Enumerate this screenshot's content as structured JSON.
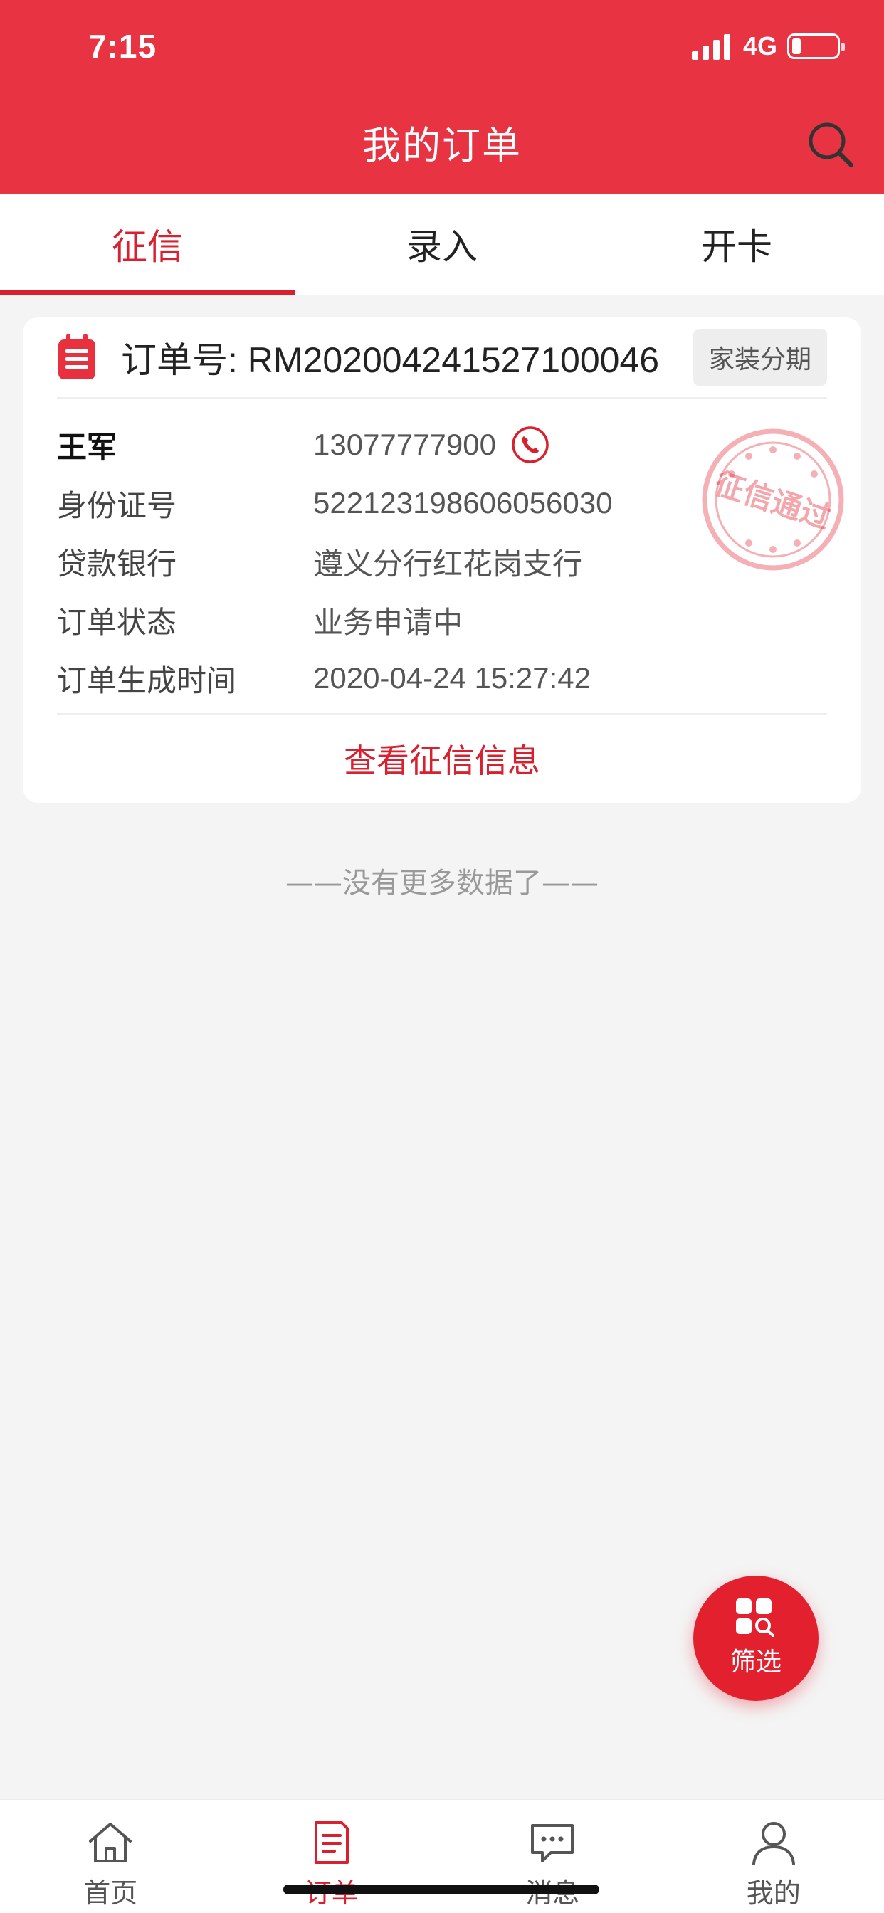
{
  "status_bar": {
    "time": "7:15",
    "network": "4G"
  },
  "header": {
    "title": "我的订单"
  },
  "tabs": [
    {
      "label": "征信",
      "active": true
    },
    {
      "label": "录入",
      "active": false
    },
    {
      "label": "开卡",
      "active": false
    }
  ],
  "order": {
    "number_text": "订单号: RM202004241527100046",
    "type_badge": "家装分期",
    "rows": [
      {
        "label": "王军",
        "value": "13077777900"
      },
      {
        "label": "身份证号",
        "value": "522123198606056030"
      },
      {
        "label": "贷款银行",
        "value": "遵义分行红花岗支行"
      },
      {
        "label": "订单状态",
        "value": "业务申请中"
      },
      {
        "label": "订单生成时间",
        "value": "2020-04-24 15:27:42"
      }
    ],
    "stamp_text": "征信通过",
    "view_link": "查看征信信息"
  },
  "list_end_text": "——没有更多数据了——",
  "filter_button": {
    "label": "筛选"
  },
  "bottom_nav": [
    {
      "label": "首页",
      "icon": "home-icon",
      "active": false
    },
    {
      "label": "订单",
      "icon": "order-icon",
      "active": true
    },
    {
      "label": "消息",
      "icon": "message-icon",
      "active": false
    },
    {
      "label": "我的",
      "icon": "profile-icon",
      "active": false
    }
  ],
  "colors": {
    "brand_red": "#e83343",
    "accent_red": "#d9202f",
    "background": "#f4f4f4"
  }
}
